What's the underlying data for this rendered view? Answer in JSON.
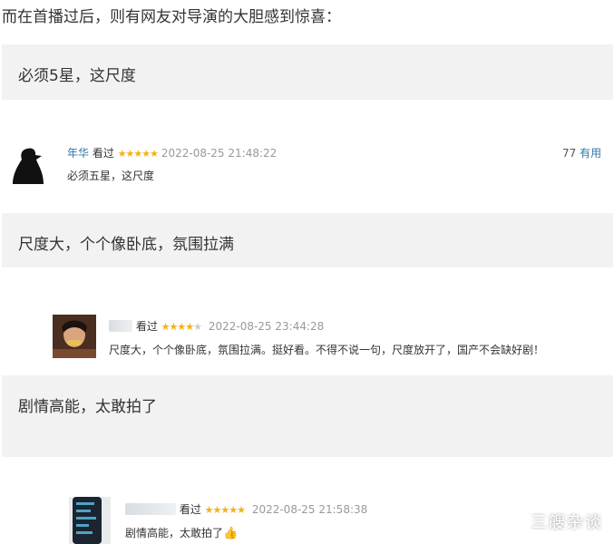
{
  "intro": "而在首播过后，则有网友对导演的大胆感到惊喜：",
  "quotes": [
    "必须5星，这尺度",
    "尺度大，个个像卧底，氛围拉满",
    "剧情高能，太敢拍了"
  ],
  "reviews": [
    {
      "user": "年华",
      "seen": "看过",
      "rating": 5,
      "date": "2022-08-25 21:48:22",
      "useful_count": "77",
      "useful_label": "有用",
      "text": "必须五星，这尺度"
    },
    {
      "user": "",
      "seen": "看过",
      "rating": 4,
      "date": "2022-08-25 23:44:28",
      "text": "尺度大，个个像卧底，氛围拉满。挺好看。不得不说一句，尺度放开了，国产不会缺好剧！"
    },
    {
      "user": "",
      "seen": "看过",
      "rating": 5,
      "date": "2022-08-25 21:58:38",
      "text": "剧情高能，太敢拍了",
      "icon": "thumbs-up-icon"
    }
  ],
  "watermark": "三艘杂谈",
  "colors": {
    "quote_bg": "#f2f2f2",
    "username": "#3377aa",
    "star": "#f5b014",
    "date": "#999999"
  }
}
